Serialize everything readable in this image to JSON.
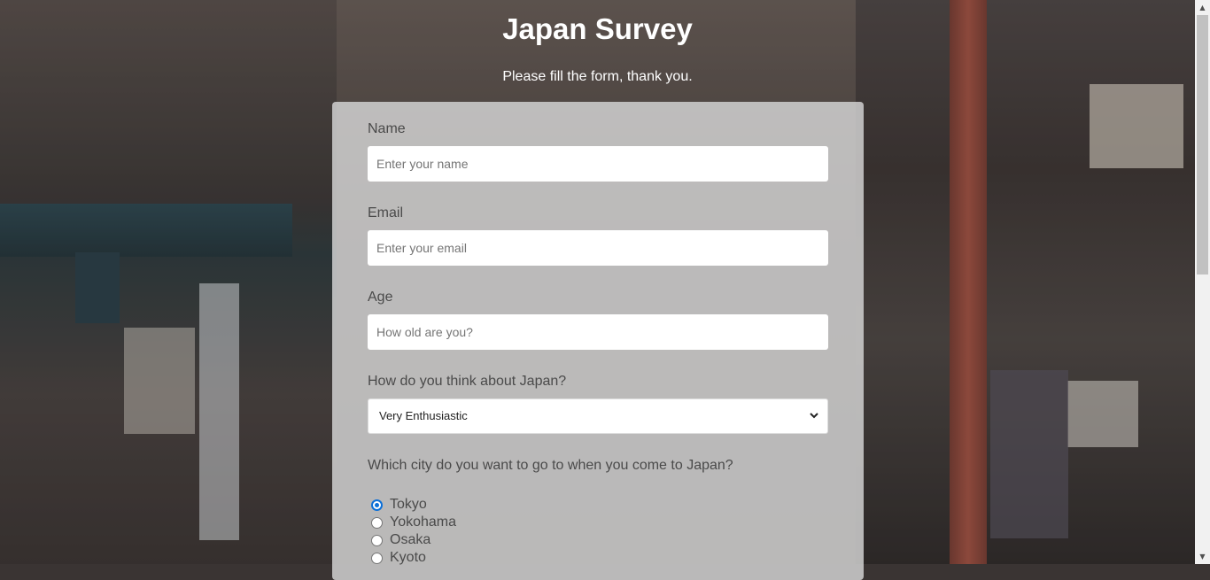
{
  "header": {
    "title": "Japan Survey",
    "subtitle": "Please fill the form, thank you."
  },
  "form": {
    "name": {
      "label": "Name",
      "placeholder": "Enter your name",
      "value": ""
    },
    "email": {
      "label": "Email",
      "placeholder": "Enter your email",
      "value": ""
    },
    "age": {
      "label": "Age",
      "placeholder": "How old are you?",
      "value": ""
    },
    "opinion": {
      "label": "How do you think about Japan?",
      "selected": "Very Enthusiastic"
    },
    "city": {
      "label": "Which city do you want to go to when you come to Japan?",
      "options": [
        {
          "label": "Tokyo",
          "checked": true
        },
        {
          "label": "Yokohama",
          "checked": false
        },
        {
          "label": "Osaka",
          "checked": false
        },
        {
          "label": "Kyoto",
          "checked": false
        }
      ]
    }
  },
  "colors": {
    "accent": "#0b6fd8"
  }
}
